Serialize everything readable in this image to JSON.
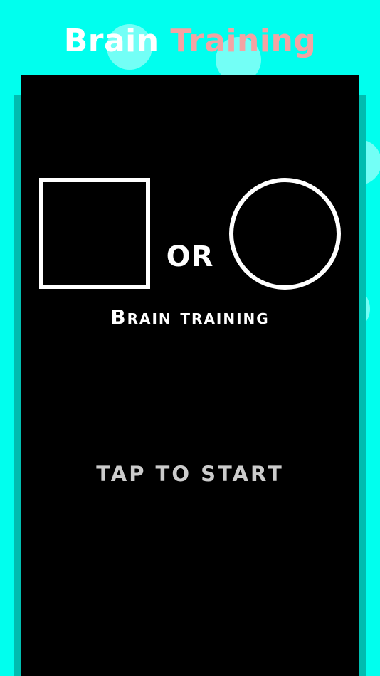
{
  "header": {
    "title_word_1": "Brain",
    "title_word_2": "Training",
    "title_word_1_color": "#FFFFFF",
    "title_word_2_color": "#F4A3A3"
  },
  "colors": {
    "background": "#00FFEE",
    "card": "#000000",
    "card_shadow": "#00BDB0"
  },
  "game": {
    "shapes": [
      "square",
      "circle"
    ],
    "or_label": "OR",
    "subtitle": "Brain training",
    "start_label": "TAP TO START"
  }
}
